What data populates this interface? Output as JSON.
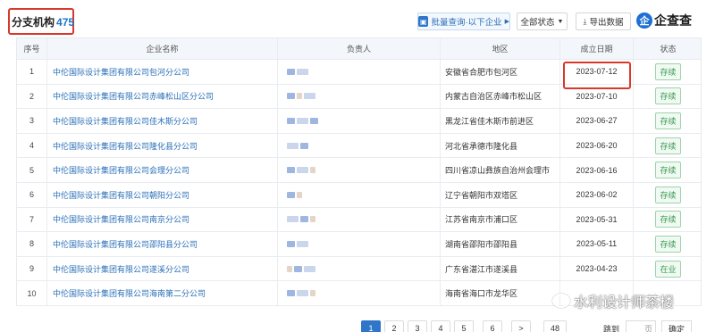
{
  "header": {
    "title": "分支机构",
    "count": "475",
    "batch_label": "批量查询·以下企业",
    "status_filter_label": "全部状态",
    "export_label": "导出数据",
    "logo_mark": "企",
    "logo_text": "企查查"
  },
  "table": {
    "columns": [
      "序号",
      "企业名称",
      "负责人",
      "地区",
      "成立日期",
      "状态"
    ],
    "rows": [
      {
        "no": "1",
        "name": "中伦国际设计集团有限公司包河分公司",
        "region": "安徽省合肥市包河区",
        "date": "2023-07-12",
        "status": "存续"
      },
      {
        "no": "2",
        "name": "中伦国际设计集团有限公司赤峰松山区分公司",
        "region": "内蒙古自治区赤峰市松山区",
        "date": "2023-07-10",
        "status": "存续"
      },
      {
        "no": "3",
        "name": "中伦国际设计集团有限公司佳木斯分公司",
        "region": "黑龙江省佳木斯市前进区",
        "date": "2023-06-27",
        "status": "存续"
      },
      {
        "no": "4",
        "name": "中伦国际设计集团有限公司隆化县分公司",
        "region": "河北省承德市隆化县",
        "date": "2023-06-20",
        "status": "存续"
      },
      {
        "no": "5",
        "name": "中伦国际设计集团有限公司会理分公司",
        "region": "四川省凉山彝族自治州会理市",
        "date": "2023-06-16",
        "status": "存续"
      },
      {
        "no": "6",
        "name": "中伦国际设计集团有限公司朝阳分公司",
        "region": "辽宁省朝阳市双塔区",
        "date": "2023-06-02",
        "status": "存续"
      },
      {
        "no": "7",
        "name": "中伦国际设计集团有限公司南京分公司",
        "region": "江苏省南京市浦口区",
        "date": "2023-05-31",
        "status": "存续"
      },
      {
        "no": "8",
        "name": "中伦国际设计集团有限公司邵阳县分公司",
        "region": "湖南省邵阳市邵阳县",
        "date": "2023-05-11",
        "status": "存续"
      },
      {
        "no": "9",
        "name": "中伦国际设计集团有限公司遂溪分公司",
        "region": "广东省湛江市遂溪县",
        "date": "2023-04-23",
        "status": "在业"
      },
      {
        "no": "10",
        "name": "中伦国际设计集团有限公司海南第二分公司",
        "region": "海南省海口市龙华区",
        "date": "",
        "status": ""
      }
    ]
  },
  "pager": {
    "pages": [
      "1",
      "2",
      "3",
      "4",
      "5",
      "6",
      ">",
      "48"
    ],
    "jump_label": "跳到",
    "page_unit": "页",
    "go_label": "确定"
  },
  "watermark": {
    "text": "水利设计师茶楼"
  },
  "colors": {
    "accent": "#2f76c9",
    "link": "#2a6fb8",
    "highlight": "#d9382b",
    "status_green": "#3a9a52"
  }
}
